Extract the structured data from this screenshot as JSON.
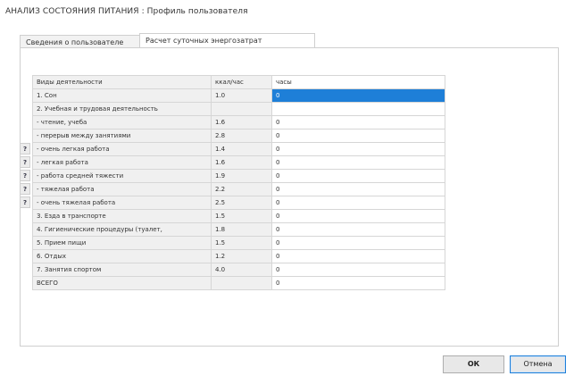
{
  "window": {
    "title": "АНАЛИЗ СОСТОЯНИЯ ПИТАНИЯ : Профиль пользователя"
  },
  "tabs": [
    {
      "label": "Сведения о пользователе"
    },
    {
      "label": "Расчет суточных энергозатрат"
    }
  ],
  "table": {
    "columns": [
      "Виды деятельности",
      "ккал/час",
      "часы"
    ],
    "rows": [
      {
        "activity": "1. Сон",
        "kcal": "1.0",
        "hours": "0",
        "selected": true
      },
      {
        "activity": "2. Учебная и трудовая деятельность",
        "kcal": "",
        "hours": ""
      },
      {
        "activity": " - чтение, учеба",
        "kcal": "1.6",
        "hours": "0"
      },
      {
        "activity": " - перерыв между занятиями",
        "kcal": "2.8",
        "hours": "0"
      },
      {
        "activity": " - очень легкая работа",
        "kcal": "1.4",
        "hours": "0",
        "help": "?"
      },
      {
        "activity": " - легкая работа",
        "kcal": "1.6",
        "hours": "0",
        "help": "?"
      },
      {
        "activity": " - работа средней тяжести",
        "kcal": "1.9",
        "hours": "0",
        "help": "?"
      },
      {
        "activity": " - тяжелая работа",
        "kcal": "2.2",
        "hours": "0",
        "help": "?"
      },
      {
        "activity": " - очень тяжелая работа",
        "kcal": "2.5",
        "hours": "0",
        "help": "?"
      },
      {
        "activity": "3. Езда в транспорте",
        "kcal": "1.5",
        "hours": "0"
      },
      {
        "activity": "4. Гигиенические процедуры (туалет,",
        "kcal": "1.8",
        "hours": "0"
      },
      {
        "activity": "5. Прием пищи",
        "kcal": "1.5",
        "hours": "0"
      },
      {
        "activity": "6. Отдых",
        "kcal": "1.2",
        "hours": "0"
      },
      {
        "activity": "7. Занятия спортом",
        "kcal": "4.0",
        "hours": "0"
      },
      {
        "activity": "ВСЕГО",
        "kcal": "",
        "hours": "0"
      }
    ]
  },
  "buttons": {
    "ok": "ОК",
    "cancel": "Отмена"
  },
  "colors": {
    "selection": "#1e7fd8",
    "grid_fill": "#f0f0f0",
    "border": "#d6d6d6"
  }
}
